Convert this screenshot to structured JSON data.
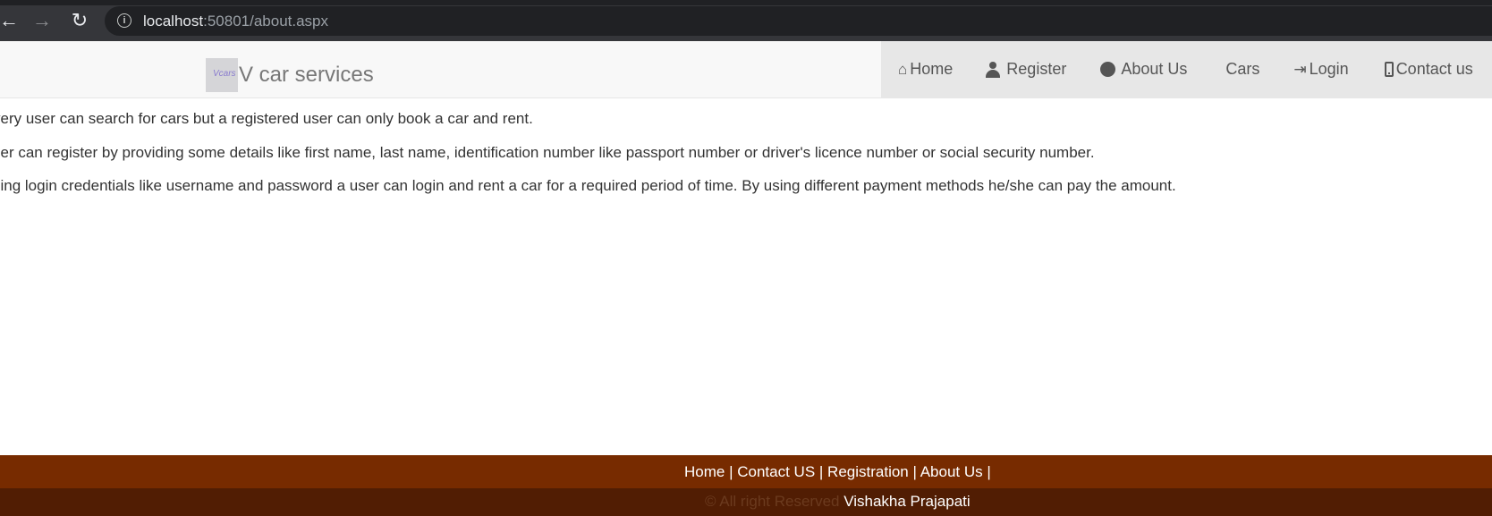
{
  "browser": {
    "url_host": "localhost",
    "url_rest": ":50801/about.aspx",
    "back_icon": "←",
    "forward_icon": "→",
    "reload_icon": "↻",
    "info_icon": "i"
  },
  "header": {
    "brand_text": "V car services",
    "logo_text": "Vcars",
    "nav": [
      {
        "label": "Home",
        "icon": "home-icon"
      },
      {
        "label": "Register",
        "icon": "user-icon"
      },
      {
        "label": "About Us",
        "icon": "info-icon"
      },
      {
        "label": "Cars",
        "icon": ""
      },
      {
        "label": "Login",
        "icon": "login-icon"
      },
      {
        "label": "Contact us",
        "icon": "phone-icon"
      }
    ],
    "icons": {
      "home": "⌂",
      "info": "!",
      "login": "⇥"
    }
  },
  "content": {
    "paragraphs": [
      "very user can search for cars but a registered user can only book a car and rent.",
      "ser can register by providing some details like first name, last name, identification number like passport number or driver's licence number or social security number.",
      "sing login credentials like username and password a user can login and rent a car for a required period of time. By using different payment methods he/she can pay the amount."
    ]
  },
  "footer": {
    "links": [
      {
        "label": "Home",
        "sep": " | "
      },
      {
        "label": "Contact US",
        "sep": " | "
      },
      {
        "label": "Registration",
        "sep": " | "
      },
      {
        "label": "About Us",
        "sep": " |"
      }
    ],
    "copyright": "© All right Reserved ",
    "author": "Vishakha Prajapati"
  }
}
